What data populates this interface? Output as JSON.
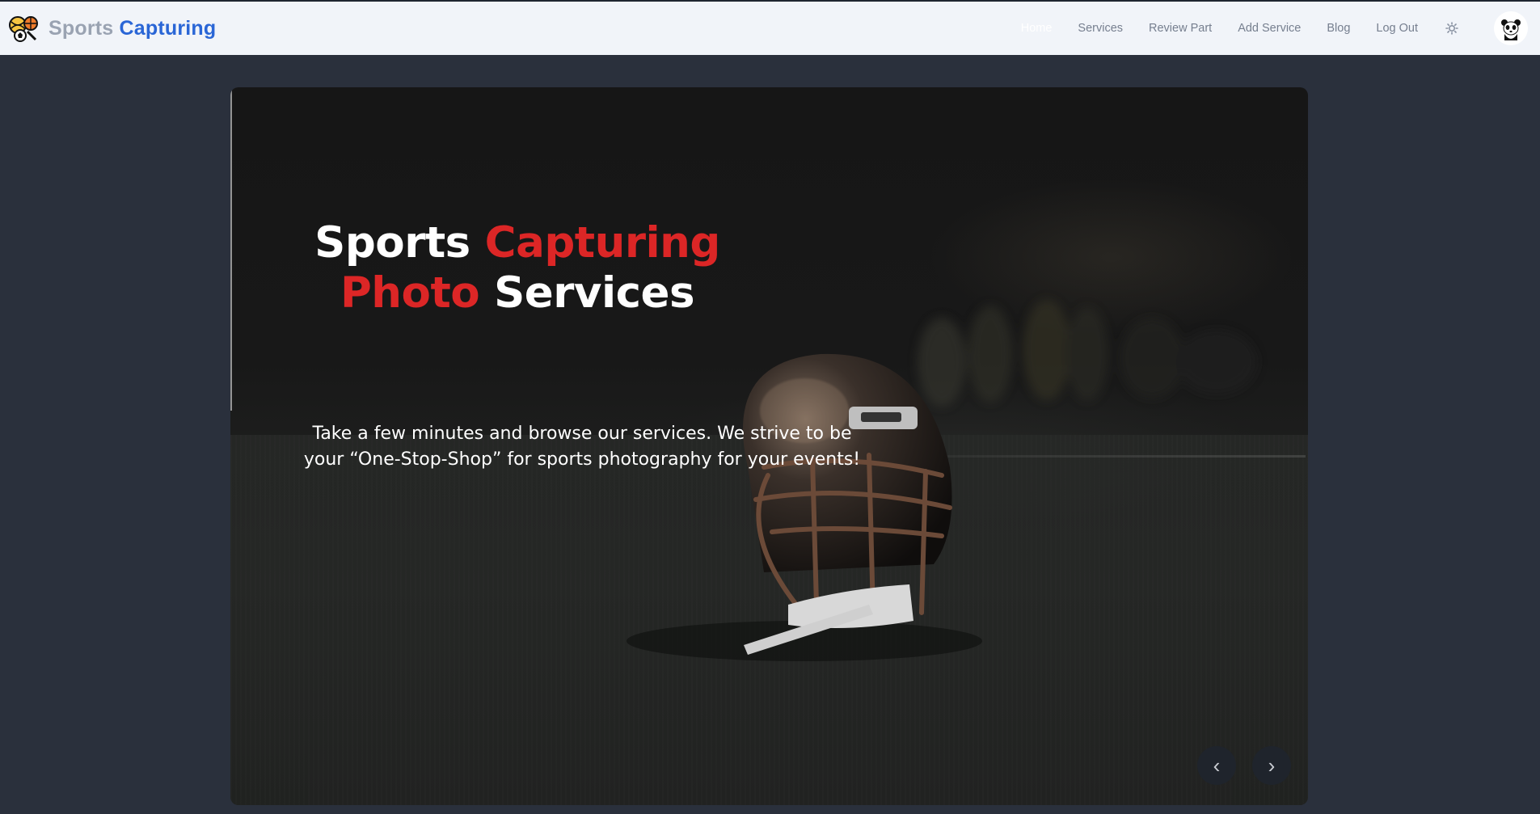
{
  "brand": {
    "word1": "Sports",
    "word2": "Capturing",
    "logo_icon": "sports-balls-logo-icon"
  },
  "nav": {
    "items": [
      {
        "label": "Home",
        "active": true
      },
      {
        "label": "Services",
        "active": false
      },
      {
        "label": "Review Part",
        "active": false
      },
      {
        "label": "Add Service",
        "active": false
      },
      {
        "label": "Blog",
        "active": false
      },
      {
        "label": "Log Out",
        "active": false
      }
    ],
    "theme_icon": "sun-icon",
    "avatar_icon": "panda-avatar-icon"
  },
  "hero": {
    "title_part1": "Sports",
    "title_part2": "Capturing",
    "title_part3": "Photo",
    "title_part4": "Services",
    "description": "Take a few minutes and browse our services. We strive to be your “One-Stop-Shop” for sports photography for your events!",
    "prev_label": "‹",
    "next_label": "›"
  },
  "colors": {
    "brand_gray": "#9aa3b2",
    "brand_blue": "#2a66d6",
    "accent_red": "#dc2626",
    "page_bg": "#2a303c",
    "navbar_bg": "#f1f4f9"
  }
}
